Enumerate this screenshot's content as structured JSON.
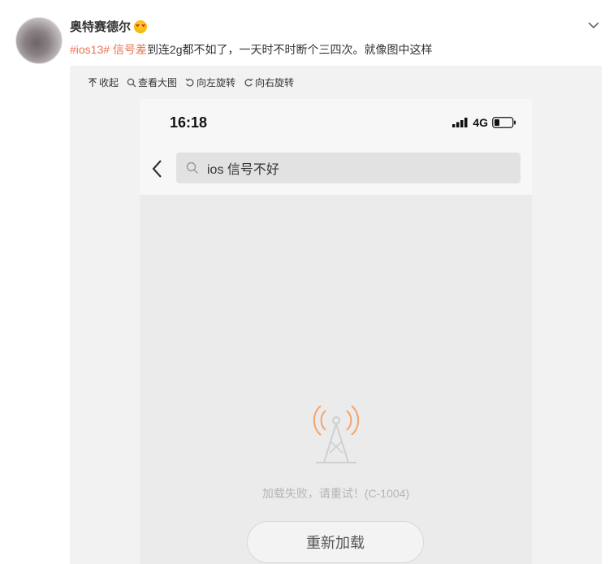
{
  "post": {
    "username": "奥特赛德尔",
    "username_emoji": "angry-face-icon",
    "hashtag1": "#ios13#",
    "hashtag2": "信号差",
    "text": "到连2g都不如了，一天时不时断个三四次。就像图中这样"
  },
  "toolbar": {
    "collapse": "收起",
    "view_large": "查看大图",
    "rotate_left": "向左旋转",
    "rotate_right": "向右旋转"
  },
  "phone": {
    "time": "16:18",
    "network": "4G",
    "search_text": "ios 信号不好",
    "error": "加载失败，请重试！(C-1004)",
    "reload": "重新加载"
  },
  "colors": {
    "tag": "#eb7350",
    "tower_waves": "#f3a46b",
    "tower": "#cfcfcf"
  }
}
